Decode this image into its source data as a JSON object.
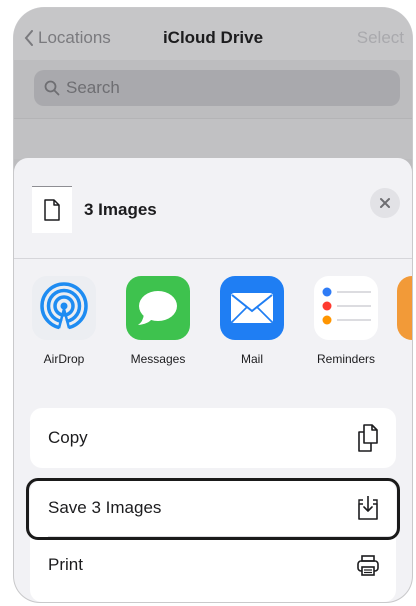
{
  "nav": {
    "back_label": "Locations",
    "title": "iCloud Drive",
    "select_label": "Select"
  },
  "search": {
    "placeholder": "Search"
  },
  "share_sheet": {
    "title": "3 Images",
    "apps": [
      {
        "label": "AirDrop",
        "icon": "airdrop-icon"
      },
      {
        "label": "Messages",
        "icon": "messages-icon"
      },
      {
        "label": "Mail",
        "icon": "mail-icon"
      },
      {
        "label": "Reminders",
        "icon": "reminders-icon"
      }
    ],
    "actions_primary": [
      {
        "label": "Copy",
        "icon": "copy-icon"
      }
    ],
    "actions_secondary": [
      {
        "label": "Save 3 Images",
        "icon": "save-to-files-icon",
        "highlighted": true
      },
      {
        "label": "Print",
        "icon": "print-icon"
      }
    ]
  },
  "colors": {
    "messages": "#3ec24e",
    "mail": "#1f7ef3",
    "airdrop": "#1e8cf2",
    "highlight_outline": "#1a1a1a"
  }
}
